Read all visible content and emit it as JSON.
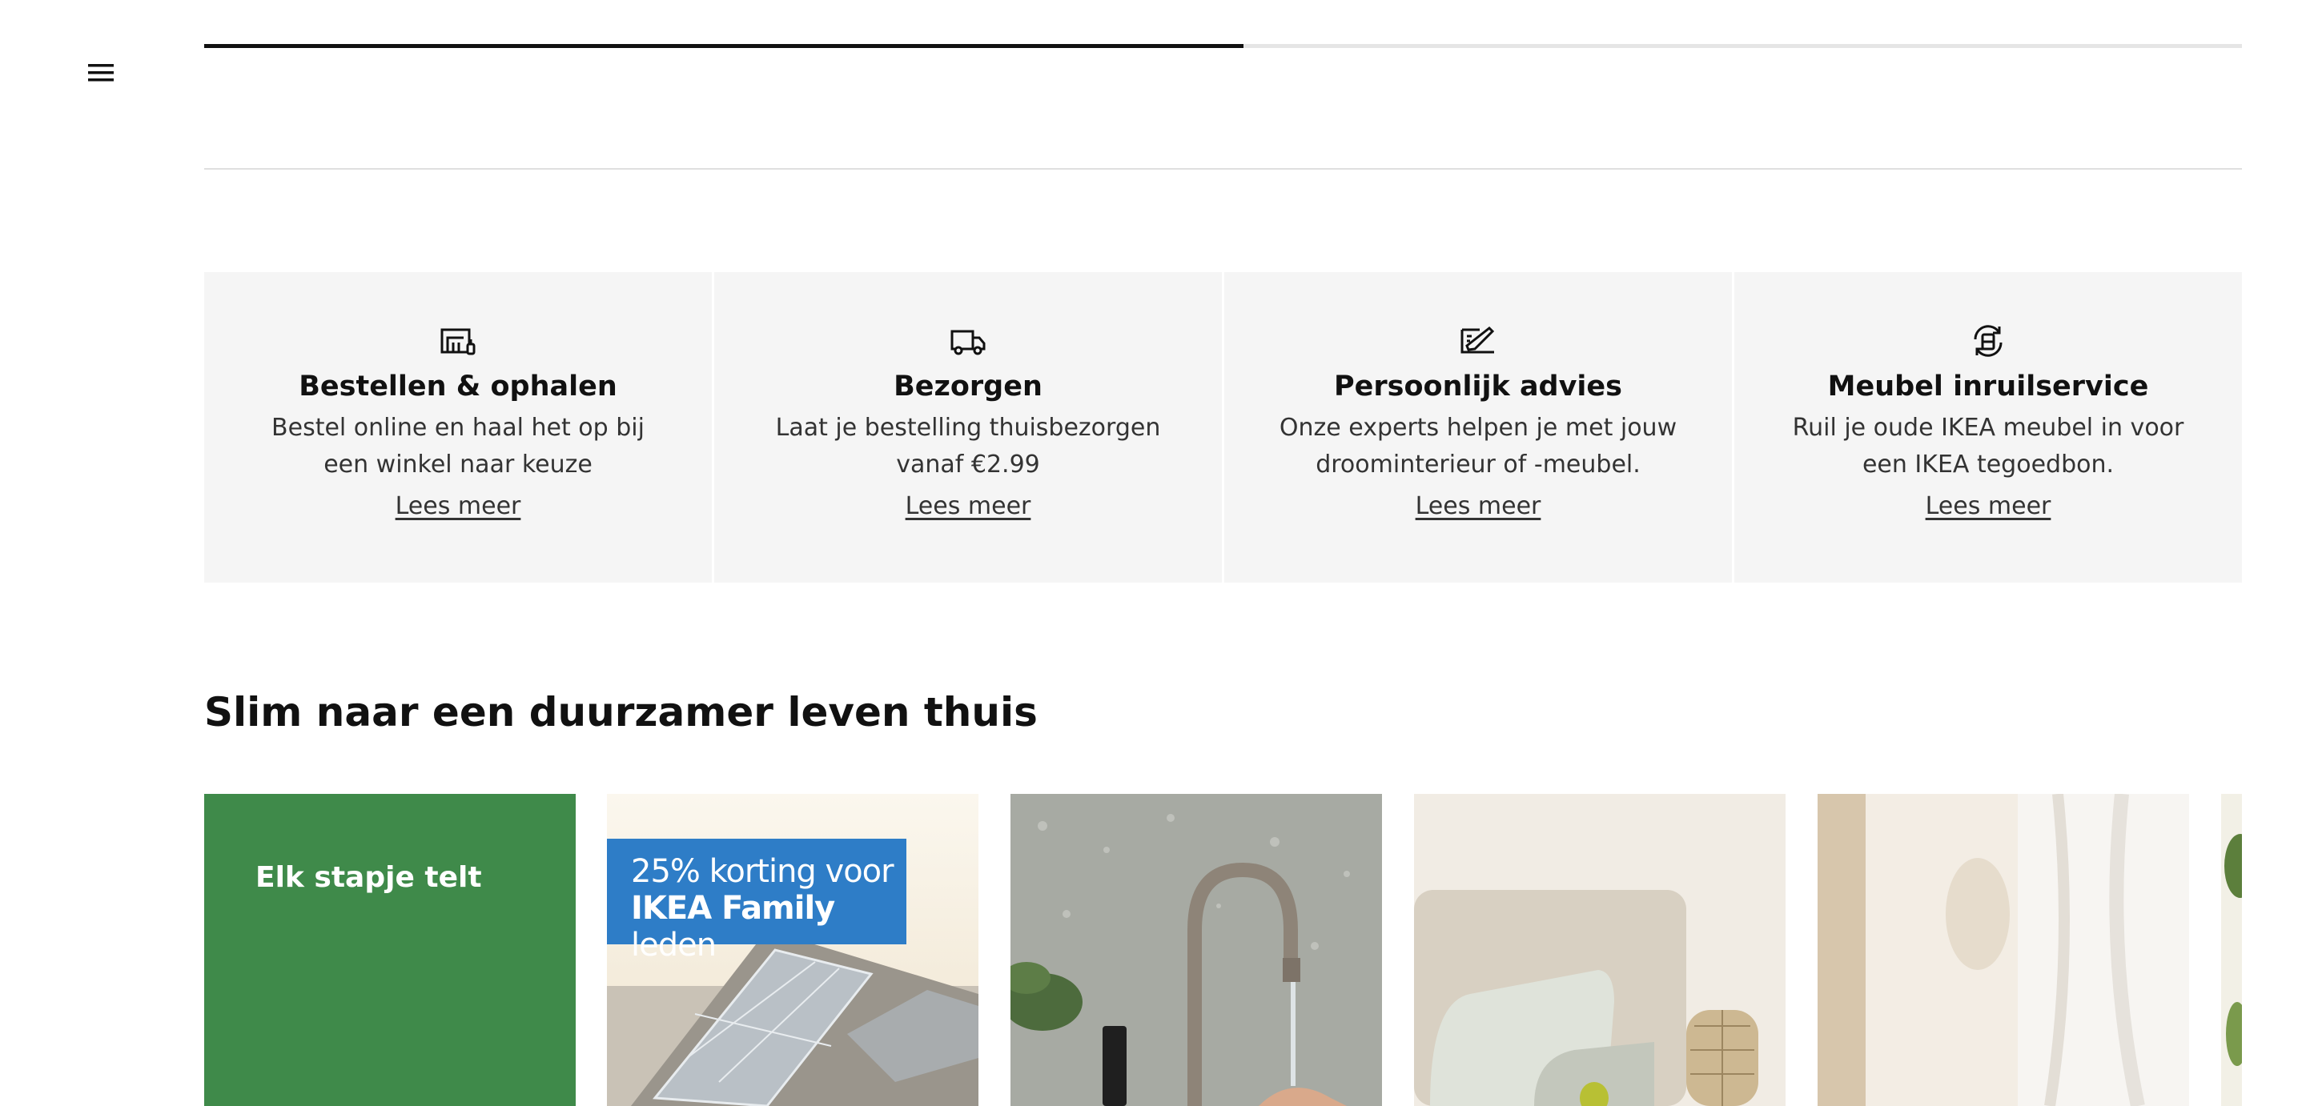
{
  "header": {
    "menu_icon": "hamburger-menu-icon",
    "scroll_progress": 0.51
  },
  "services": [
    {
      "icon": "store-pickup-icon",
      "title": "Bestellen & ophalen",
      "description": "Bestel online en haal het op bij een winkel naar keuze",
      "link": "Lees meer"
    },
    {
      "icon": "delivery-truck-icon",
      "title": "Bezorgen",
      "description": "Laat je bestelling thuisbezorgen vanaf €2.99",
      "link": "Lees meer"
    },
    {
      "icon": "design-advice-icon",
      "title": "Persoonlijk advies",
      "description": "Onze experts helpen je met jouw droominterieur of -meubel.",
      "link": "Lees meer"
    },
    {
      "icon": "furniture-buyback-icon",
      "title": "Meubel inruilservice",
      "description": "Ruil je oude IKEA meubel in voor een IKEA tegoedbon.",
      "link": "Lees meer"
    }
  ],
  "sustainability": {
    "title": "Slim naar een duurzamer leven thuis",
    "cards": [
      {
        "label": "Elk stapje telt",
        "color": "#3f8a4a"
      },
      {
        "promo_line1": "25% korting voor",
        "promo_line2_bold": "IKEA Family",
        "promo_line2_rest": " leden",
        "badge_color": "#2e7dc7"
      }
    ]
  }
}
